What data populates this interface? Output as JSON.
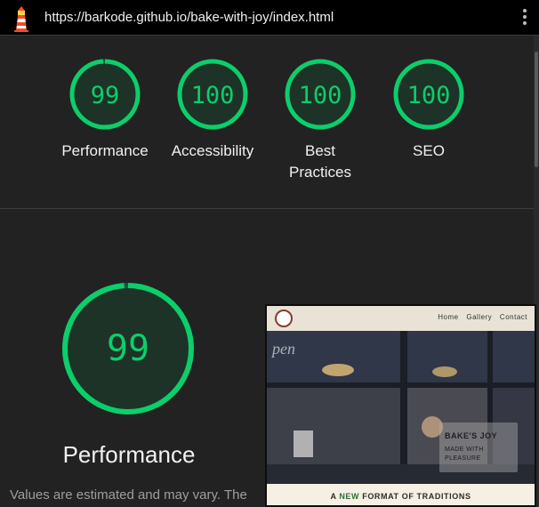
{
  "header": {
    "url": "https://barkode.github.io/bake-with-joy/index.html",
    "menu_icon": "kebab-menu-icon",
    "logo_icon": "lighthouse-icon"
  },
  "colors": {
    "pass": "#0cce6b",
    "gauge_fill": "#1d3327",
    "background": "#222222",
    "topbar": "#000000"
  },
  "scores": [
    {
      "value": "99",
      "label": "Performance"
    },
    {
      "value": "100",
      "label": "Accessibility"
    },
    {
      "value": "100",
      "label": "Best Practices",
      "label_lines": [
        "Best",
        "Practices"
      ]
    },
    {
      "value": "100",
      "label": "SEO"
    }
  ],
  "performance": {
    "score": "99",
    "title": "Performance",
    "note": "Values are estimated and may vary. The"
  },
  "screenshot": {
    "nav_links": [
      "Home",
      "Gallery",
      "Contact"
    ],
    "hero_sign": "pen",
    "overlay_title": "BAKE'S JOY",
    "overlay_subtitle_line1": "MADE WITH",
    "overlay_subtitle_line2": "PLEASURE",
    "tagline_before": "A ",
    "tagline_accent": "NEW",
    "tagline_after": " FORMAT OF TRADITIONS"
  }
}
